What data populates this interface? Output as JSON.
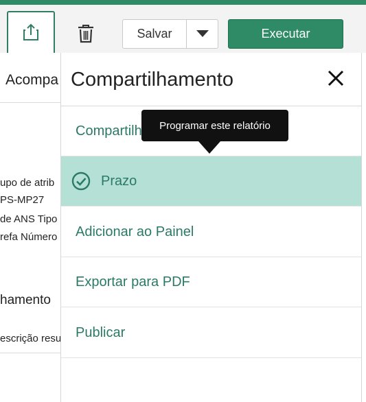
{
  "toolbar": {
    "share_icon": "share-icon",
    "trash_icon": "trash-icon",
    "save_label": "Salvar",
    "save_dropdown_icon": "caret-down-icon",
    "run_label": "Executar"
  },
  "background": {
    "tab_label": "Acompa",
    "lines": [
      "upo de atrib",
      "PS-MP27",
      "de ANS Tipo",
      "refa Número"
    ],
    "section_label": "hamento",
    "desc_label": "escrição resu"
  },
  "panel": {
    "title": "Compartilhamento",
    "close_icon": "close-icon",
    "items": [
      {
        "label": "Compartilh",
        "selected": false
      },
      {
        "label": "Prazo",
        "selected": true,
        "icon": "check-circle-icon"
      },
      {
        "label": "Adicionar ao Painel",
        "selected": false
      },
      {
        "label": "Exportar para PDF",
        "selected": false
      },
      {
        "label": "Publicar",
        "selected": false
      }
    ]
  },
  "tooltip": {
    "text": "Programar este relatório"
  },
  "colors": {
    "accent": "#2e8b66",
    "item_text": "#2a7a66",
    "selected_bg": "#b5e0d6",
    "tooltip_bg": "#111111"
  }
}
